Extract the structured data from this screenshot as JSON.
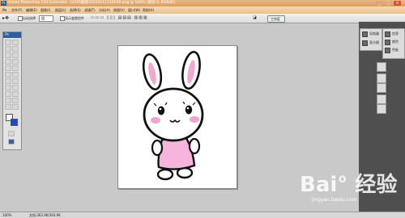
{
  "window": {
    "app_badge": "Ps",
    "title": "Adobe Photoshop CS3 Extended - [2345截图20220211110036.png @ 100% (图层 0, RGB/8)]",
    "controls": [
      "_",
      "□",
      "×"
    ]
  },
  "menu": [
    "文件(F)",
    "编辑(E)",
    "图像(I)",
    "图层(L)",
    "选择(S)",
    "滤镜(T)",
    "分析(A)",
    "视图(V)",
    "窗口(W)",
    "帮助(H)"
  ],
  "options": {
    "auto_select": "自动选择",
    "group": "组",
    "show_transform": "显示变换控件",
    "workspace": "工作区"
  },
  "toolbox": {
    "header": "Ps"
  },
  "panels": {
    "items": [
      "导航器",
      "直方图",
      "信息",
      "颜色",
      "色板",
      "样式"
    ]
  },
  "status": {
    "zoom": "100%",
    "doc": "文档:363.9K/363.9K"
  },
  "watermark": {
    "brand": "Bai° 经验",
    "url": "jingyan.baidu.com"
  },
  "colors": {
    "accent": "#2f5d9e",
    "titlebar": "#d89d63",
    "foreground": "#ffffff",
    "background": "#1f49c9"
  }
}
